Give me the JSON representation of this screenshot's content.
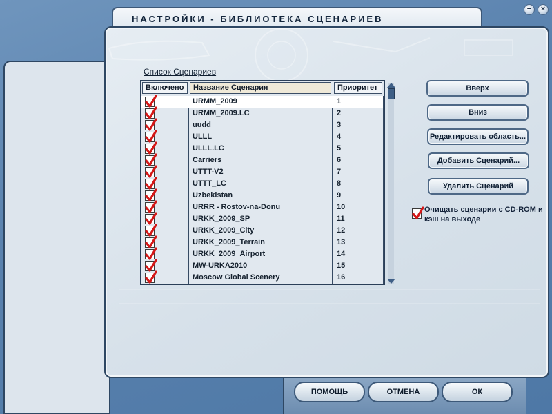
{
  "window": {
    "title": "НАСТРОЙКИ - БИБЛИОТЕКА СЦЕНАРИЕВ",
    "minimize_glyph": "−",
    "close_glyph": "×"
  },
  "scenery_list": {
    "caption": "Список Сценариев",
    "columns": [
      "Включено",
      "Название Сценария",
      "Приоритет"
    ],
    "rows": [
      {
        "enabled": true,
        "name": "URMM_2009",
        "priority": "1"
      },
      {
        "enabled": true,
        "name": "URMM_2009.LC",
        "priority": "2"
      },
      {
        "enabled": true,
        "name": "uudd",
        "priority": "3"
      },
      {
        "enabled": true,
        "name": "ULLL",
        "priority": "4"
      },
      {
        "enabled": true,
        "name": "ULLL.LC",
        "priority": "5"
      },
      {
        "enabled": true,
        "name": "Carriers",
        "priority": "6"
      },
      {
        "enabled": true,
        "name": "UTTT-V2",
        "priority": "7"
      },
      {
        "enabled": true,
        "name": "UTTT_LC",
        "priority": "8"
      },
      {
        "enabled": true,
        "name": "Uzbekistan",
        "priority": "9"
      },
      {
        "enabled": true,
        "name": "URRR - Rostov-na-Donu",
        "priority": "10"
      },
      {
        "enabled": true,
        "name": "URKK_2009_SP",
        "priority": "11"
      },
      {
        "enabled": true,
        "name": "URKK_2009_City",
        "priority": "12"
      },
      {
        "enabled": true,
        "name": "URKK_2009_Terrain",
        "priority": "13"
      },
      {
        "enabled": true,
        "name": "URKK_2009_Airport",
        "priority": "14"
      },
      {
        "enabled": true,
        "name": "MW-URKA2010",
        "priority": "15"
      },
      {
        "enabled": true,
        "name": "Moscow Global Scenery",
        "priority": "16"
      }
    ]
  },
  "buttons": {
    "up": "Вверх",
    "down": "Вниз",
    "edit_area": "Редактировать область...",
    "add_scenery": "Добавить Сценарий...",
    "delete_scenery": "Удалить Сценарий"
  },
  "cdrom_option": {
    "checked": true,
    "label": "Очищать сценарии с CD-ROM и кэш на выходе"
  },
  "dock": {
    "help": "ПОМОЩЬ",
    "cancel": "ОТМЕНА",
    "ok": "ОК"
  },
  "colors": {
    "check_mark": "#d41818",
    "frame": "#2e4763"
  }
}
